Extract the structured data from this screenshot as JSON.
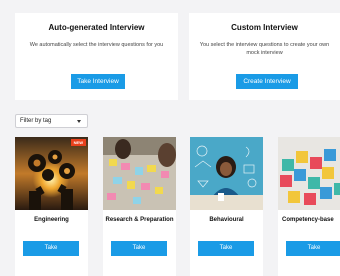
{
  "auto_card": {
    "title": "Auto-generated Interview",
    "description": "We automatically select the interview questions for you",
    "button": "Take Interview"
  },
  "custom_card": {
    "title": "Custom Interview",
    "description": "You select the interview questions to create your own mock interview",
    "button": "Create Interview"
  },
  "filter": {
    "value": "Filter by tag"
  },
  "tiles": [
    {
      "label": "Engineering",
      "badge": "NEW",
      "button": "Take"
    },
    {
      "label": "Research & Preparation",
      "button": "Take"
    },
    {
      "label": "Behavioural",
      "button": "Take"
    },
    {
      "label": "Competency-base",
      "button": "Take"
    }
  ],
  "colors": {
    "accent": "#1a9be6",
    "badge": "#e8401c",
    "background": "#f3f3f5"
  }
}
